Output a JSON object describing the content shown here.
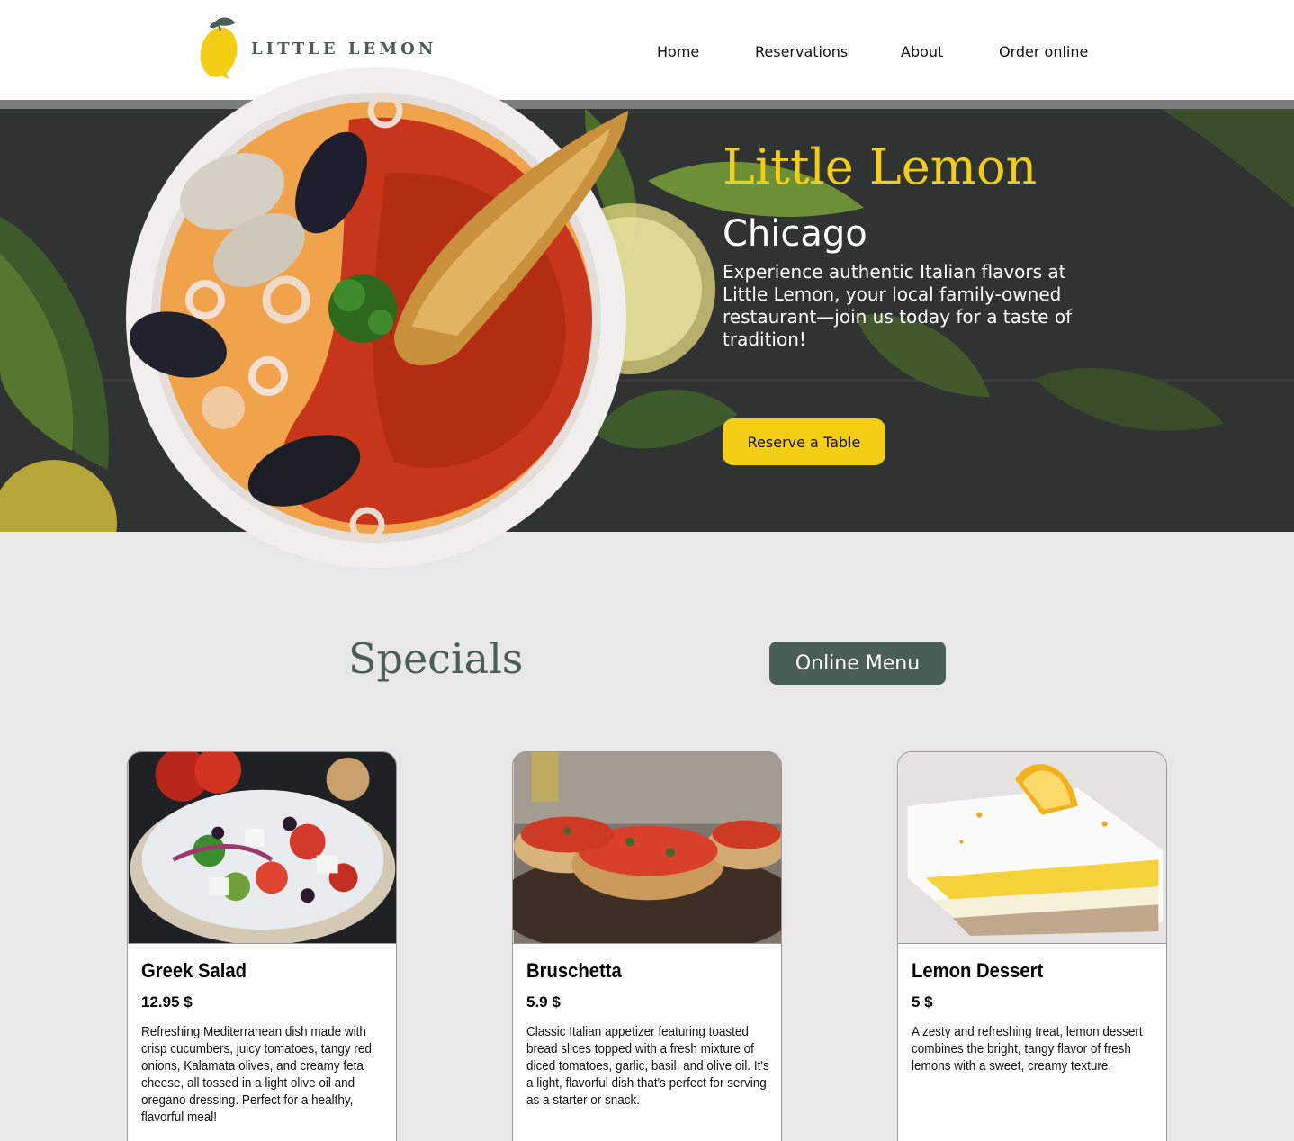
{
  "header": {
    "logo_text": "LITTLE LEMON",
    "nav": {
      "home": "Home",
      "reservations": "Reservations",
      "about": "About",
      "order": "Order online"
    }
  },
  "hero": {
    "title": "Little Lemon",
    "city": "Chicago",
    "description": "Experience authentic Italian flavors at Little Lemon, your local family-owned restaurant—join us today for a taste of tradition!",
    "cta": "Reserve a Table"
  },
  "specials": {
    "title": "Specials",
    "menu_button": "Online Menu",
    "items": [
      {
        "name": "Greek Salad",
        "price": "12.95 $",
        "description": "Refreshing Mediterranean dish made with crisp cucumbers, juicy tomatoes, tangy red onions, Kalamata olives, and creamy feta cheese, all tossed in a light olive oil and oregano dressing. Perfect for a healthy, flavorful meal!"
      },
      {
        "name": "Bruschetta",
        "price": "5.9 $",
        "description": "Classic Italian appetizer featuring toasted bread slices topped with a fresh mixture of diced tomatoes, garlic, basil, and olive oil. It's a light, flavorful dish that's perfect for serving as a starter or snack."
      },
      {
        "name": "Lemon Dessert",
        "price": "5 $",
        "description": "A zesty and refreshing treat, lemon dessert combines the bright, tangy flavor of fresh lemons with a sweet, creamy texture."
      }
    ]
  },
  "colors": {
    "primary_green": "#495e57",
    "primary_yellow": "#f4ce14"
  }
}
